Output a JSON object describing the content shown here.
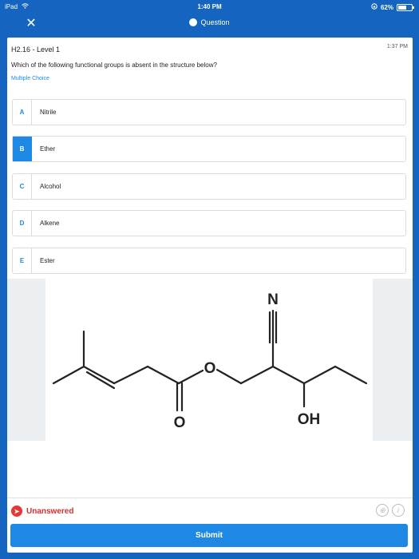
{
  "status_bar": {
    "device": "iPad",
    "time": "1:40 PM",
    "battery_text": "62%",
    "battery_level": 0.62
  },
  "nav": {
    "title": "Question"
  },
  "question": {
    "id_label": "H2.16 - Level 1",
    "time": "1:37 PM",
    "prompt": "Which of the following functional groups is absent in the structure below?",
    "type": "Multiple Choice",
    "selected": "B",
    "options": [
      {
        "letter": "A",
        "label": "Nitrile"
      },
      {
        "letter": "B",
        "label": "Ether"
      },
      {
        "letter": "C",
        "label": "Alcohol"
      },
      {
        "letter": "D",
        "label": "Alkene"
      },
      {
        "letter": "E",
        "label": "Ester"
      }
    ]
  },
  "structure": {
    "atom_n": "N",
    "atom_o_ester": "O",
    "atom_o_carbonyl": "O",
    "atom_oh": "OH"
  },
  "footer": {
    "status": "Unanswered",
    "submit_label": "Submit"
  },
  "icons": {
    "wifi": "wifi-icon",
    "close": "close-icon",
    "chat": "chat-icon",
    "alert": "alert-icon",
    "hint": "hint-icon",
    "info": "info-icon"
  },
  "colors": {
    "primary": "#1e88e5",
    "header": "#1565c0",
    "alert": "#e53935"
  }
}
